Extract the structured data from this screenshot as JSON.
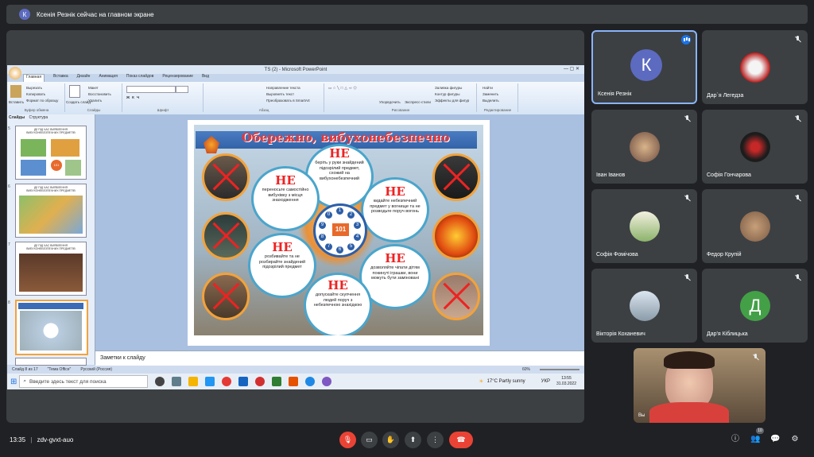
{
  "notification": {
    "initial": "К",
    "text": "Ксенія Резнік сейчас на главном экране"
  },
  "ppt": {
    "window_title": "TS (2) - Microsoft PowerPoint",
    "tabs": [
      "Главная",
      "Вставка",
      "Дизайн",
      "Анимация",
      "Показ слайдов",
      "Рецензирование",
      "Вид"
    ],
    "active_tab": "Главная",
    "ribbon": {
      "clipboard": {
        "paste": "Вставить",
        "cut": "Вырезать",
        "copy": "Копировать",
        "format": "Формат по образцу",
        "group": "Буфер обмена"
      },
      "slides": {
        "create": "Создать слайд",
        "layout": "Макет",
        "restore": "Восстановить",
        "delete": "Удалить",
        "group": "Слайды"
      },
      "font": {
        "group": "Шрифт"
      },
      "paragraph": {
        "text_dir": "Направление текста",
        "align": "Выровнять текст",
        "smartart": "Преобразовать в SmartArt",
        "group": "Абзац"
      },
      "drawing": {
        "arrange": "Упорядочить",
        "quick_styles": "Экспресс-стили",
        "fill": "Заливка фигуры",
        "outline": "Контур фигуры",
        "effects": "Эффекты для фигур",
        "group": "Рисование"
      },
      "editing": {
        "find": "Найти",
        "replace": "Заменить",
        "select": "Выделить",
        "group": "Редактирование"
      }
    },
    "left_tabs": [
      "Слайды",
      "Структура"
    ],
    "thumb_titles": [
      "ДІЇ ПІД ЧАС ВИЯВЛЕННЯ ВИБУХОНЕБЕЗПЕЧНИХ ПРЕДМЕТІВ",
      "ДІЇ ПІД ЧАС ВИЯВЛЕННЯ ВИБУХОНЕБЕЗПЕЧНИХ ПРЕДМЕТІВ",
      "ДІЇ ПІД ЧАС ВИЯВЛЕННЯ ВИБУХОНЕБЕЗПЕЧНИХ ПРЕДМЕТІВ"
    ],
    "thumb_numbers": [
      "5",
      "6",
      "7",
      "8"
    ],
    "thumb_101": "101",
    "notes_placeholder": "Заметки к слайду",
    "status": {
      "slide": "Слайд 8 из 17",
      "theme": "\"Тема Office\"",
      "lang": "Русский (Россия)",
      "zoom": "60%"
    }
  },
  "slide": {
    "title": "Обережно, вибухонебезпечно",
    "bubbles": [
      {
        "ne": "НЕ",
        "text": "беріть у руки знайдений підозрілий предмет, схожий на вибухонебезпечний"
      },
      {
        "ne": "НЕ",
        "text": "переносьте самостійно вибухівку з місця знаходження"
      },
      {
        "ne": "НЕ",
        "text": "кидайте небезпечний предмет у вогнище та не розводьте поруч вогонь"
      },
      {
        "ne": "НЕ",
        "text": "розбивайте та не розбирайте знайдений підозрілий предмет"
      },
      {
        "ne": "НЕ",
        "text": "дозволяйте чіпати дітям покинуті іграшки, вони можуть бути заміновані"
      },
      {
        "ne": "НЕ",
        "text": "допускайте скупчення людей поруч з небезпечною знахідкою"
      }
    ],
    "dial_digits": [
      "1",
      "2",
      "3",
      "4",
      "5",
      "6",
      "7",
      "8",
      "9",
      "0"
    ],
    "dial_center": "101"
  },
  "taskbar": {
    "search": "Введите здесь текст для поиска",
    "weather": "17°C Partly sunny",
    "lang": "УКР",
    "time": "13:55",
    "date": "31.03.2022"
  },
  "participants": [
    {
      "name": "Ксенія Резнік",
      "initial": "К",
      "color": "#5c6bc0",
      "speaking": true
    },
    {
      "name": "Дар`я Легедза",
      "initial": "",
      "color": "#b71c1c"
    },
    {
      "name": "Іван Іванов",
      "initial": "",
      "color": "#6d4c41"
    },
    {
      "name": "Софія Гончарова",
      "initial": "",
      "color": "#263238"
    },
    {
      "name": "Софія Фомічова",
      "initial": "",
      "color": "#8d6e63"
    },
    {
      "name": "Федор Крупій",
      "initial": "",
      "color": "#a1887f"
    },
    {
      "name": "Вікторія Коханевич",
      "initial": "",
      "color": "#90a4ae"
    },
    {
      "name": "Дар'я Кіблицька",
      "initial": "Д",
      "color": "#43a047"
    }
  ],
  "self_view": {
    "label": "Вы"
  },
  "meeting": {
    "time": "13:35",
    "code": "zdv-gvxt-auo",
    "participant_count": "10"
  }
}
